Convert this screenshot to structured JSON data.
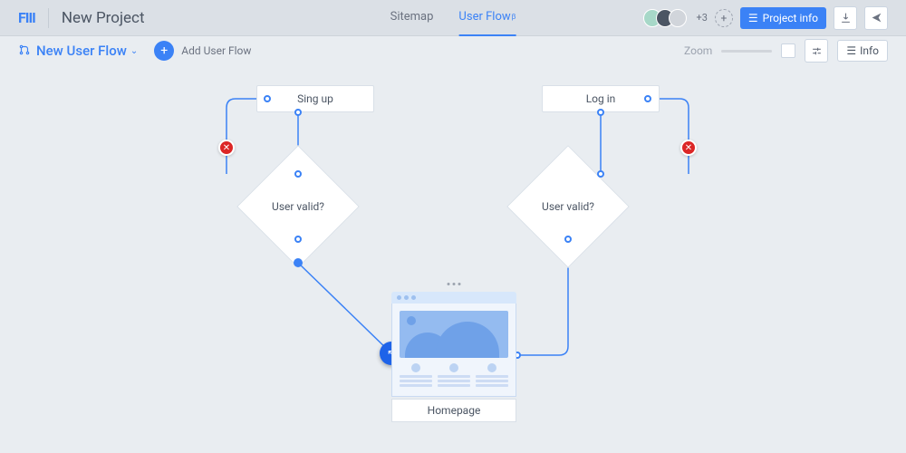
{
  "header": {
    "logo": "FIII",
    "project_title": "New Project",
    "tabs": {
      "sitemap": "Sitemap",
      "userflow": "User Flow",
      "userflow_sup": "β"
    },
    "avatars_plus": "+3",
    "project_info_btn": "Project info"
  },
  "toolbar": {
    "flow_name": "New User Flow",
    "add_flow": "Add User Flow",
    "zoom_label": "Zoom",
    "info_btn": "Info"
  },
  "nodes": {
    "signup": "Sing up",
    "login": "Log in",
    "valid1": "User valid?",
    "valid2": "User valid?",
    "homepage": "Homepage"
  }
}
